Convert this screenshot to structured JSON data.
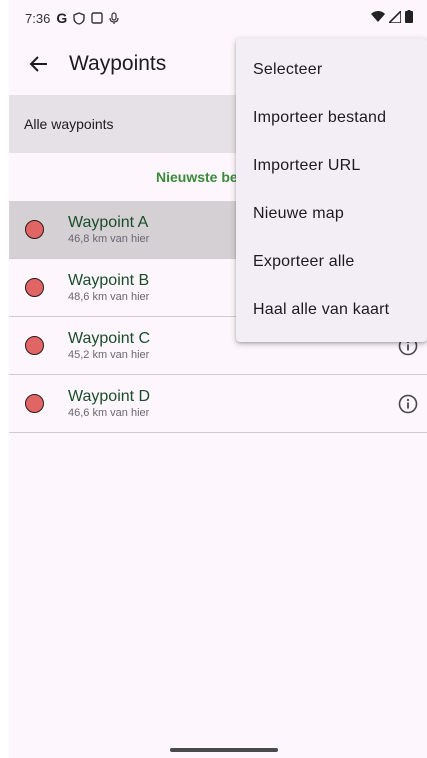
{
  "status": {
    "time": "7:36"
  },
  "appbar": {
    "title": "Waypoints"
  },
  "filter": {
    "label": "Alle waypoints"
  },
  "sort": {
    "label": "Nieuwste be"
  },
  "waypoints": [
    {
      "name": "Waypoint A",
      "distance": "46,8 km van hier",
      "selected": true
    },
    {
      "name": "Waypoint B",
      "distance": "48,6 km van hier",
      "selected": false
    },
    {
      "name": "Waypoint C",
      "distance": "45,2 km van hier",
      "selected": false
    },
    {
      "name": "Waypoint D",
      "distance": "46,6 km van hier",
      "selected": false
    }
  ],
  "menu": {
    "items": [
      "Selecteer",
      "Importeer bestand",
      "Importeer URL",
      "Nieuwe map",
      "Exporteer alle",
      "Haal alle van kaart"
    ]
  },
  "colors": {
    "marker": "#e26565",
    "accent": "#3a8a3a",
    "selected_row": "#d4d0d4"
  }
}
